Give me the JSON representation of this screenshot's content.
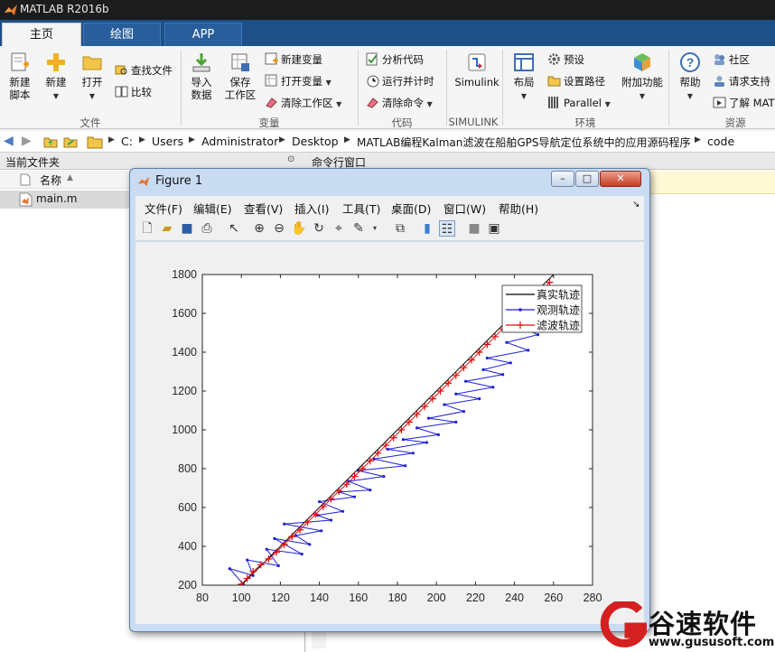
{
  "window": {
    "title": "MATLAB R2016b"
  },
  "tabs": [
    {
      "label": "主页"
    },
    {
      "label": "绘图"
    },
    {
      "label": "APP"
    }
  ],
  "ribbon": {
    "file": {
      "new_script": "新建\n脚本",
      "new": "新建",
      "open": "打开",
      "find_files": "查找文件",
      "compare": "比较",
      "group": "文件"
    },
    "variable": {
      "import": "导入\n数据",
      "save_ws": "保存\n工作区",
      "new_var": "新建变量",
      "open_var": "打开变量",
      "clear_ws": "清除工作区",
      "group": "变量"
    },
    "code": {
      "analyze": "分析代码",
      "run_time": "运行并计时",
      "clear_cmd": "清除命令",
      "group": "代码"
    },
    "simulink": {
      "label": "Simulink",
      "group": "SIMULINK"
    },
    "env": {
      "layout": "布局",
      "prefs": "预设",
      "set_path": "设置路径",
      "parallel": "Parallel",
      "addons": "附加功能",
      "group": "环境"
    },
    "resources": {
      "help": "帮助",
      "community": "社区",
      "support": "请求支持",
      "learn": "了解 MAT",
      "group": "资源"
    }
  },
  "address": [
    "C:",
    "Users",
    "Administrator",
    "Desktop",
    "MATLAB编程Kalman滤波在船舶GPS导航定位系统中的应用源码程序",
    "code"
  ],
  "left_panel": {
    "title": "当前文件夹",
    "col_name": "名称",
    "file": "main.m"
  },
  "right_panel": {
    "title": "命令行窗口"
  },
  "figure": {
    "title": "Figure 1",
    "menus": [
      "文件(F)",
      "编辑(E)",
      "查看(V)",
      "插入(I)",
      "工具(T)",
      "桌面(D)",
      "窗口(W)",
      "帮助(H)"
    ]
  },
  "chart_data": {
    "type": "line",
    "xlim": [
      80,
      280
    ],
    "ylim": [
      200,
      1800
    ],
    "xticks": [
      80,
      100,
      120,
      140,
      160,
      180,
      200,
      220,
      240,
      260,
      280
    ],
    "yticks": [
      200,
      400,
      600,
      800,
      1000,
      1200,
      1400,
      1600,
      1800
    ],
    "legend_position": "top-right",
    "series": [
      {
        "name": "真实轨迹",
        "color": "#000000",
        "x": [
          100,
          120,
          140,
          160,
          180,
          200,
          220,
          240,
          260
        ],
        "y": [
          200,
          400,
          600,
          800,
          1000,
          1200,
          1400,
          1600,
          1800
        ]
      },
      {
        "name": "观测轨迹",
        "color": "#1f1fd8",
        "x": [
          101,
          94,
          106,
          103,
          119,
          113,
          131,
          117,
          135,
          128,
          141,
          122,
          146,
          139,
          152,
          140,
          158,
          150,
          166,
          155,
          173,
          160,
          184,
          168,
          188,
          175,
          195,
          183,
          201,
          190,
          210,
          196,
          214,
          204,
          222,
          210,
          229,
          215,
          234,
          224,
          238,
          226,
          247,
          236,
          252,
          243,
          258,
          249,
          262
        ],
        "y": [
          205,
          285,
          250,
          330,
          300,
          385,
          360,
          440,
          410,
          455,
          480,
          515,
          535,
          560,
          580,
          630,
          655,
          680,
          690,
          735,
          760,
          790,
          815,
          850,
          880,
          900,
          935,
          950,
          975,
          1010,
          1040,
          1060,
          1095,
          1130,
          1160,
          1185,
          1220,
          1250,
          1285,
          1310,
          1345,
          1370,
          1410,
          1450,
          1490,
          1530,
          1580,
          1640,
          1700
        ]
      },
      {
        "name": "滤波轨迹",
        "color": "#e01010",
        "x": [
          100,
          103,
          106,
          110,
          114,
          118,
          122,
          126,
          130,
          134,
          138,
          142,
          146,
          150,
          154,
          158,
          162,
          166,
          170,
          174,
          178,
          182,
          186,
          190,
          194,
          198,
          202,
          206,
          210,
          214,
          218,
          222,
          226,
          230,
          234,
          238,
          242,
          246,
          250,
          254,
          258
        ],
        "y": [
          205,
          235,
          270,
          305,
          335,
          370,
          410,
          450,
          485,
          525,
          565,
          605,
          645,
          685,
          720,
          760,
          800,
          840,
          880,
          920,
          960,
          1000,
          1040,
          1080,
          1120,
          1160,
          1200,
          1240,
          1280,
          1320,
          1360,
          1400,
          1440,
          1480,
          1520,
          1560,
          1600,
          1640,
          1680,
          1720,
          1760
        ]
      }
    ]
  },
  "watermark": {
    "brand": "谷速软件",
    "url": "www.gususoft.com"
  }
}
